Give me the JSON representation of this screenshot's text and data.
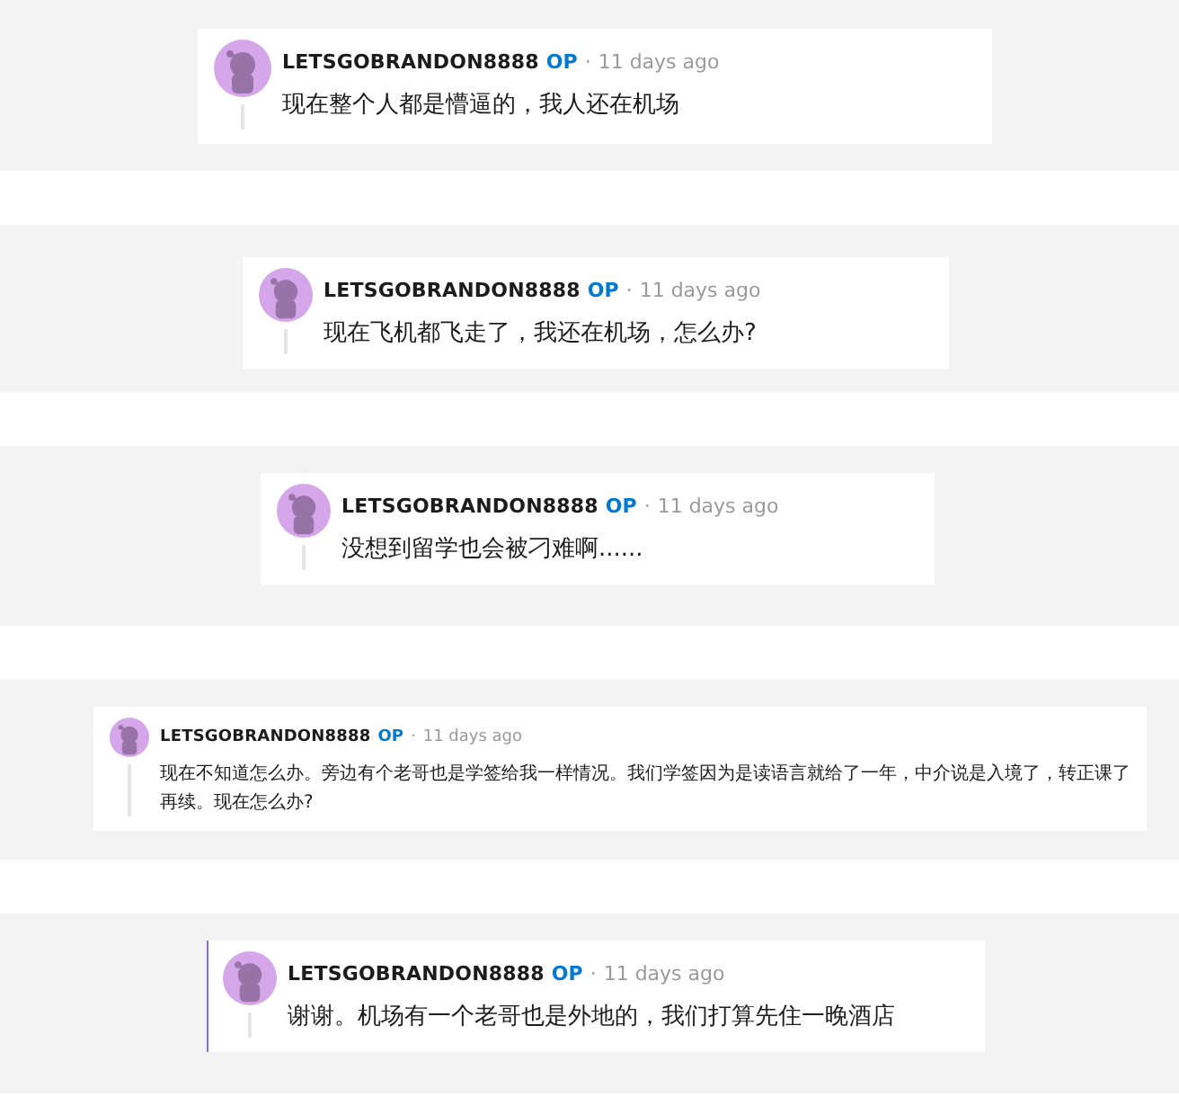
{
  "comments": [
    {
      "author": "LETSGOBRANDON8888",
      "badge": "OP",
      "separator": "·",
      "time": "11 days ago",
      "text": "现在整个人都是懵逼的，我人还在机场",
      "highlighted": false
    },
    {
      "author": "LETSGOBRANDON8888",
      "badge": "OP",
      "separator": "·",
      "time": "11 days ago",
      "text": "现在飞机都飞走了，我还在机场，怎么办?",
      "highlighted": false
    },
    {
      "author": "LETSGOBRANDON8888",
      "badge": "OP",
      "separator": "·",
      "time": "11 days ago",
      "text": "没想到留学也会被刁难啊......",
      "highlighted": false
    },
    {
      "author": "LETSGOBRANDON8888",
      "badge": "OP",
      "separator": "·",
      "time": "11 days ago",
      "text": "现在不知道怎么办。旁边有个老哥也是学签给我一样情况。我们学签因为是读语言就给了一年，中介说是入境了，转正课了再续。现在怎么办?",
      "highlighted": false
    },
    {
      "author": "LETSGOBRANDON8888",
      "badge": "OP",
      "separator": "·",
      "time": "11 days ago",
      "text": "谢谢。机场有一个老哥也是外地的，我们打算先住一晚酒店",
      "highlighted": true
    }
  ]
}
